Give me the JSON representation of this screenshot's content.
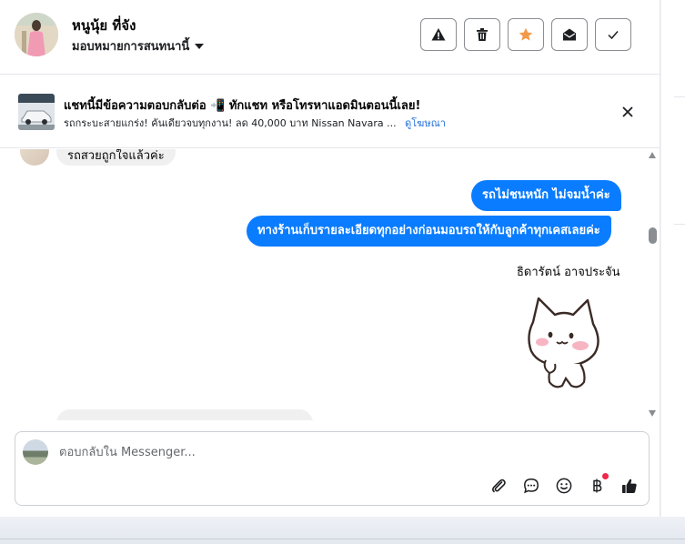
{
  "header": {
    "name": "หนูนุ้ย ที่จัง",
    "assign_label": "มอบหมายการสนทนานี้",
    "tools": [
      "warning-icon",
      "trash-icon",
      "star-icon",
      "mark-unread-icon",
      "done-check-icon"
    ]
  },
  "ad": {
    "title": "แชทนี้มีข้อความตอบกลับต่อ 📲 ทักแชท หรือโทรหาแอดมินตอนนี้เลย!",
    "subtitle": "รถกระบะสายแกร่ง! คันเดียวจบทุกงาน! ลด 40,000 บาท Nissan Navara ...",
    "link": "ดูโฆษณา"
  },
  "messages": {
    "incoming_top": "รถสวยถูกใจแล้วค่ะ",
    "outgoing_1": "รถไม่ชนหนัก ไม่จมน้ำค่ะ",
    "outgoing_2": "ทางร้านเก็บรายละเอียดทุกอย่างก่อนมอบรถให้กับลูกค้าทุกเคสเลยค่ะ",
    "sender": "ธิดารัตน์ อาจประจัน",
    "incoming_bottom": ""
  },
  "composer": {
    "placeholder": "ตอบกลับใน Messenger...",
    "icons": [
      "attach-icon",
      "saved-reply-icon",
      "emoji-icon",
      "baht-payment-icon",
      "like-icon"
    ]
  },
  "colors": {
    "accent": "#0a7cff",
    "link": "#216fdb",
    "star": "#f2994a",
    "badge": "#f02849"
  }
}
